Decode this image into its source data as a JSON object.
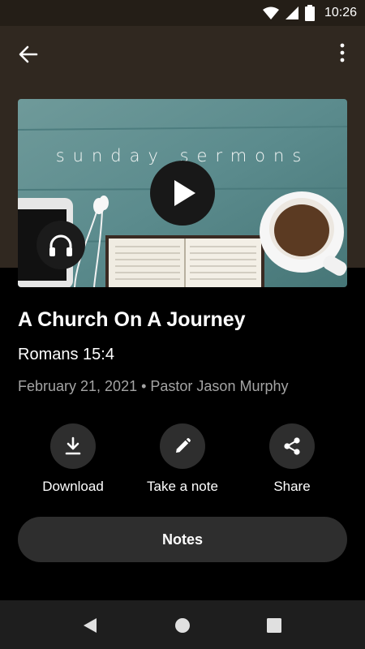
{
  "status_bar": {
    "time": "10:26",
    "icons": [
      "wifi-icon",
      "cell-signal-icon",
      "battery-icon"
    ]
  },
  "app_bar": {
    "back_icon": "arrow-back-icon",
    "menu_icon": "more-vert-icon"
  },
  "artwork": {
    "title_text": "sunday sermons"
  },
  "sermon": {
    "title": "A Church On A Journey",
    "scripture": "Romans 15:4",
    "meta": "February 21, 2021 • Pastor Jason Murphy"
  },
  "actions": [
    {
      "label": "Download",
      "icon": "download-icon"
    },
    {
      "label": "Take a note",
      "icon": "pencil-icon"
    },
    {
      "label": "Share",
      "icon": "share-icon"
    }
  ],
  "notes_button": {
    "label": "Notes"
  },
  "nav_bar": {
    "icons": [
      "nav-back-icon",
      "nav-home-icon",
      "nav-recents-icon"
    ]
  },
  "colors": {
    "header_bg": "#302820",
    "status_bg": "#241e17",
    "button_bg": "#2e2e2e",
    "meta_text": "#a4a4a4"
  }
}
